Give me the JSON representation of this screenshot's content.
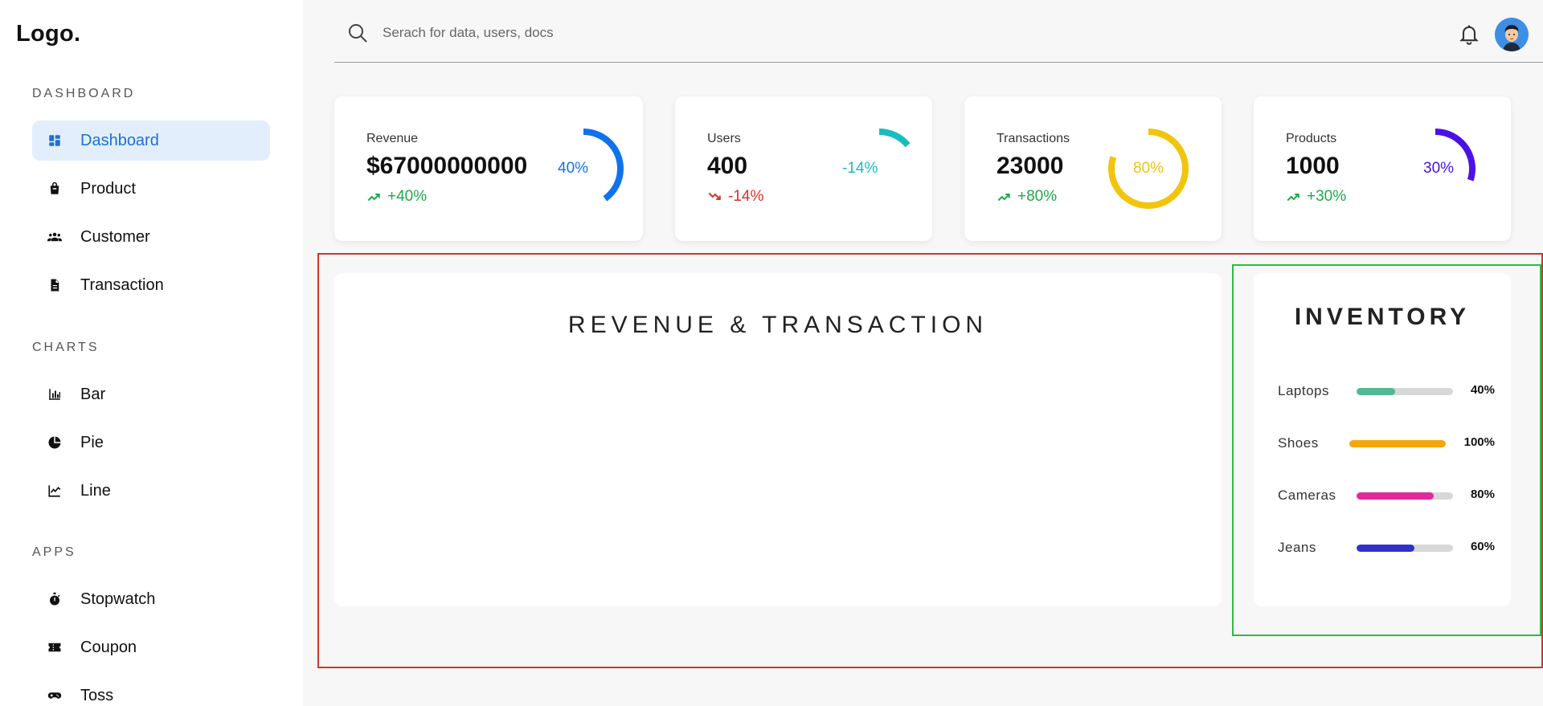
{
  "app": {
    "logo": "Logo."
  },
  "sidebar": {
    "sections": [
      {
        "title": "DASHBOARD",
        "items": [
          {
            "label": "Dashboard",
            "icon": "dashboard-icon",
            "active": true
          },
          {
            "label": "Product",
            "icon": "shopping-bag-icon"
          },
          {
            "label": "Customer",
            "icon": "people-icon"
          },
          {
            "label": "Transaction",
            "icon": "document-icon"
          }
        ]
      },
      {
        "title": "CHARTS",
        "items": [
          {
            "label": "Bar",
            "icon": "bar-chart-icon"
          },
          {
            "label": "Pie",
            "icon": "pie-chart-icon"
          },
          {
            "label": "Line",
            "icon": "line-chart-icon"
          }
        ]
      },
      {
        "title": "APPS",
        "items": [
          {
            "label": "Stopwatch",
            "icon": "stopwatch-icon"
          },
          {
            "label": "Coupon",
            "icon": "coupon-icon"
          },
          {
            "label": "Toss",
            "icon": "gamepad-icon"
          }
        ]
      }
    ]
  },
  "search": {
    "placeholder": "Serach for data, users, docs",
    "value": ""
  },
  "widgets": [
    {
      "label": "Revenue",
      "value": "$67000000000",
      "trend": "+40%",
      "trend_dir": "up",
      "percent": 40,
      "percent_label": "40%",
      "color": "#0f73ee"
    },
    {
      "label": "Users",
      "value": "400",
      "trend": "-14%",
      "trend_dir": "down",
      "percent": 14,
      "percent_label": "-14%",
      "color": "#18bdbf"
    },
    {
      "label": "Transactions",
      "value": "23000",
      "trend": "+80%",
      "trend_dir": "up",
      "percent": 80,
      "percent_label": "80%",
      "color": "#f2c40c"
    },
    {
      "label": "Products",
      "value": "1000",
      "trend": "+30%",
      "trend_dir": "up",
      "percent": 30,
      "percent_label": "30%",
      "color": "#4b12e8"
    }
  ],
  "chart": {
    "title": "REVENUE & TRANSACTION"
  },
  "inventory": {
    "title": "INVENTORY",
    "items": [
      {
        "name": "Laptops",
        "percent": 40,
        "percent_label": "40%",
        "color": "#52b894"
      },
      {
        "name": "Shoes",
        "percent": 100,
        "percent_label": "100%",
        "color": "#f5a60a"
      },
      {
        "name": "Cameras",
        "percent": 80,
        "percent_label": "80%",
        "color": "#e02a9c"
      },
      {
        "name": "Jeans",
        "percent": 60,
        "percent_label": "60%",
        "color": "#3131c9"
      }
    ]
  },
  "colors": {
    "accent": "#1f6fd1",
    "active_bg": "#e2eefb",
    "trend_up": "#1ea94b",
    "trend_down": "#d93025",
    "outline_red": "#c93a2a",
    "outline_green": "#2dbb46"
  }
}
